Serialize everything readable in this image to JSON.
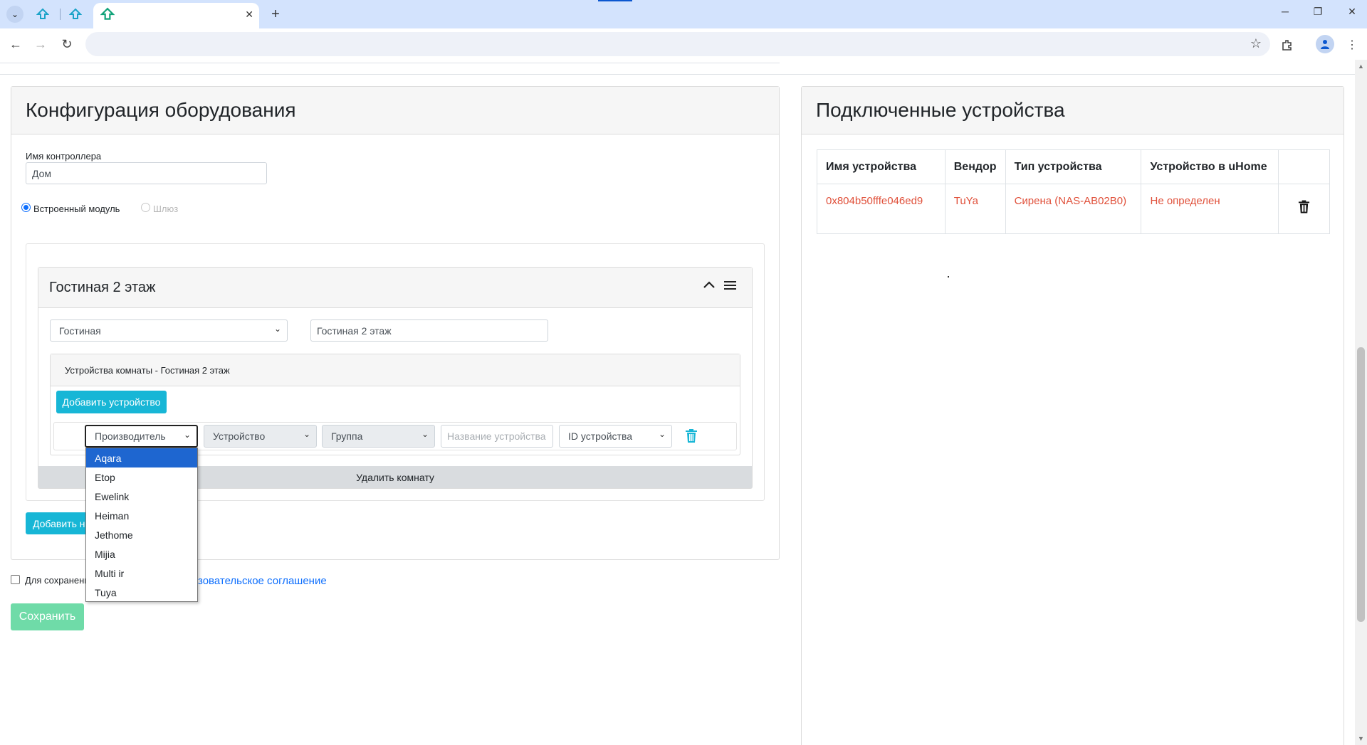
{
  "browser": {
    "tabs": [
      {
        "icon": "house-arrow-icon"
      },
      {
        "icon": "house-arrow-icon"
      },
      {
        "icon": "house-arrow-icon",
        "active": true
      }
    ],
    "close_glyph": "✕",
    "new_tab_glyph": "+",
    "address": ""
  },
  "left_card": {
    "title": "Конфигурация оборудования",
    "controller_label": "Имя контроллера",
    "controller_value": "Дом",
    "radio_builtin": "Встроенный модуль",
    "radio_gateway": "Шлюз",
    "room": {
      "title": "Гостиная 2 этаж",
      "type_select": "Гостиная",
      "name_value": "Гостиная 2 этаж",
      "devices_header": "Устройства комнаты - Гостиная 2 этаж",
      "add_device": "Добавить устройство",
      "device_row": {
        "vendor": "Производитель",
        "device": "Устройство",
        "group": "Группа",
        "name_placeholder": "Название устройства",
        "id": "ID устройства"
      },
      "delete_room": "Удалить комнату"
    },
    "add_room": "Добавить н"
  },
  "vendor_options": [
    "Aqara",
    "Etop",
    "Ewelink",
    "Heiman",
    "Jethome",
    "Mijia",
    "Multi ir",
    "Tuya"
  ],
  "agreement": {
    "label": "Для сохранени",
    "link": "зовательское соглашение"
  },
  "save_button": "Сохранить",
  "right_card": {
    "title": "Подключенные устройства",
    "columns": [
      "Имя устройства",
      "Вендор",
      "Тип устройства",
      "Устройство в uHome"
    ],
    "rows": [
      {
        "name": "0x804b50fffe046ed9",
        "vendor": "TuYa",
        "type": "Сирена (NAS-AB02B0)",
        "uhome": "Не определен"
      }
    ]
  },
  "colors": {
    "accent": "#17b6d6",
    "danger_text": "#e0503a",
    "save": "#6fdba8",
    "link": "#0d6efd"
  }
}
